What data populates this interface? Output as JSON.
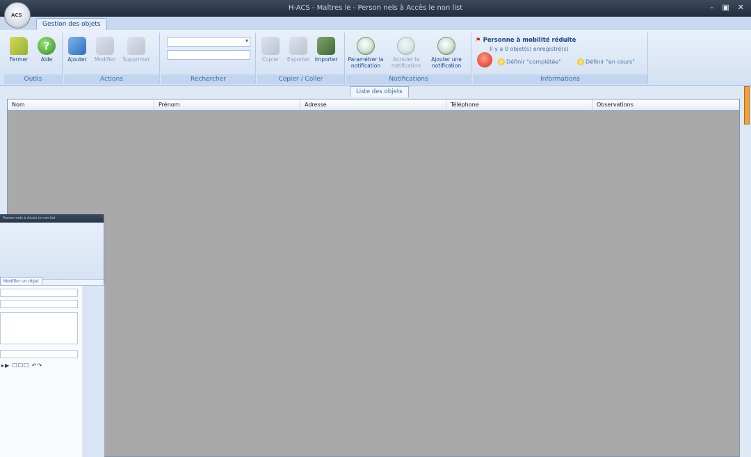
{
  "window": {
    "title": "H-ACS - Maîtres le - Person nels à Accès le non list",
    "logo_text": "ACS",
    "controls": [
      "–",
      "▣",
      "✕"
    ]
  },
  "tabs": {
    "main": "Gestion des objets"
  },
  "ribbon": {
    "outils": {
      "label": "Outils",
      "fermer": "Fermer",
      "aide": "Aide"
    },
    "actions": {
      "label": "Actions",
      "ajouter": "Ajouter",
      "modifier": "Modifier",
      "supprimer": "Supprimer"
    },
    "recherche": {
      "label": "Rechercher",
      "combo_value": "",
      "search_value": ""
    },
    "copier_coller": {
      "label": "Copier / Coller",
      "copier": "Copier",
      "exporter": "Exporter",
      "importer": "Importer"
    },
    "notifications": {
      "label": "Notifications",
      "parametrer": "Paramétrer la notification",
      "annuler": "Annuler la notification",
      "ajouter": "Ajouter une notification"
    },
    "informations": {
      "label": "Informations",
      "title": "Personne à mobilité réduite",
      "line": "Il y a 0 objet(s) enregistré(s)",
      "def_completee": "Définir \"complétée\"",
      "def_en_cours": "Définir \"en cours\""
    }
  },
  "list": {
    "tab_label": "Liste des objets",
    "columns": [
      "Nom",
      "Prénom",
      "Adresse",
      "Téléphone",
      "Observations"
    ]
  },
  "secondary_window": {
    "title": "Person nels à Accès le non list",
    "tab_label": "Modifier un objet"
  },
  "colors": {
    "accent": "#15428b",
    "grid_bg": "#a9a9a9",
    "title_bg": "#1f2b3a"
  },
  "icons": [
    "folder-icon",
    "help-icon",
    "add-icon",
    "edit-icon",
    "delete-icon",
    "copy-icon",
    "export-icon",
    "import-icon",
    "notification-icon",
    "flag-icon",
    "lamp-icon"
  ]
}
